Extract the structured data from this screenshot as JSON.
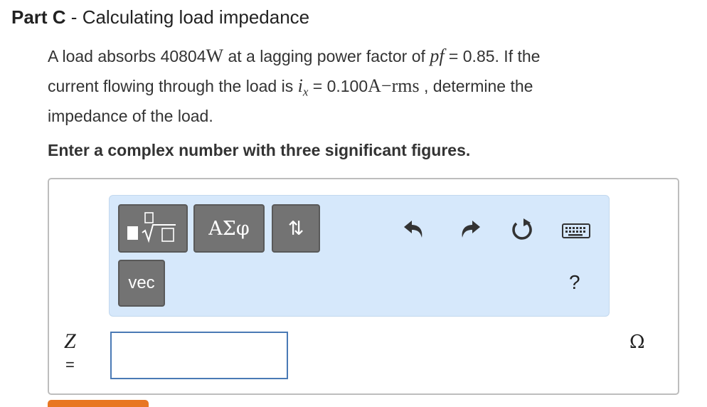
{
  "header": {
    "part_label": "Part C",
    "separator": " - ",
    "title": "Calculating load impedance"
  },
  "problem": {
    "s1": "A load absorbs ",
    "power_value": "40804",
    "power_unit": "W",
    "s2": " at a lagging power factor of ",
    "pf_symbol": "pf",
    "s3": " = 0.85. If the",
    "s4": "current flowing through the load is ",
    "i_symbol": "i",
    "i_sub": "x",
    "s5": " = 0.100",
    "current_unit": "A−rms",
    "s6": " , determine the",
    "s7": "impedance of the load."
  },
  "instruction": "Enter a complex number with three significant figures.",
  "toolbar": {
    "greek_label": "ΑΣφ",
    "arrows_label": "⇅",
    "vec_label": "vec",
    "help_label": "?"
  },
  "answer": {
    "variable": "Z",
    "equals": "=",
    "value": "",
    "unit": "Ω"
  },
  "icons": {
    "templates": "templates-icon",
    "undo": "undo-icon",
    "redo": "redo-icon",
    "reset": "reset-icon",
    "keyboard": "keyboard-icon"
  },
  "colors": {
    "toolbar_bg": "#d6e8fb",
    "button_bg": "#737373",
    "input_border": "#4a7ab5",
    "submit_orange": "#e87722"
  }
}
